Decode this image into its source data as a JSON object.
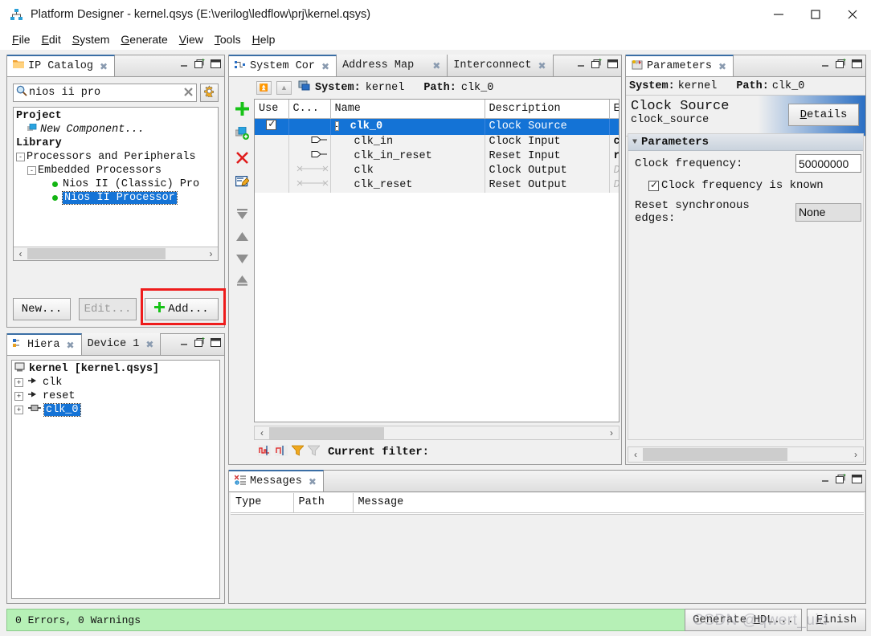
{
  "window": {
    "title": "Platform Designer - kernel.qsys (E:\\verilog\\ledflow\\prj\\kernel.qsys)",
    "icon": "platform-designer-icon",
    "minimize": "—",
    "maximize": "□",
    "close": "✕"
  },
  "menubar": {
    "items": [
      {
        "label": "File",
        "mnemonic": "F"
      },
      {
        "label": "Edit",
        "mnemonic": "E"
      },
      {
        "label": "System",
        "mnemonic": "S"
      },
      {
        "label": "Generate",
        "mnemonic": "G"
      },
      {
        "label": "View",
        "mnemonic": "V"
      },
      {
        "label": "Tools",
        "mnemonic": "T"
      },
      {
        "label": "Help",
        "mnemonic": "H"
      }
    ]
  },
  "ip_catalog": {
    "tab_label": "IP Catalog",
    "tab_close": "✖",
    "search_value": "nios ii pro",
    "search_placeholder": "",
    "clear_label": "✖",
    "tree": [
      {
        "label": "Project",
        "style": "bold",
        "indent": 0,
        "expander": "",
        "icon": "",
        "selected": false
      },
      {
        "label": "New Component...",
        "style": "italic",
        "indent": 1,
        "expander": "",
        "icon": "component-icon",
        "selected": false
      },
      {
        "label": "Library",
        "style": "bold",
        "indent": 0,
        "expander": "",
        "icon": "",
        "selected": false
      },
      {
        "label": "Processors and Peripherals",
        "style": "",
        "indent": 0,
        "expander": "-",
        "icon": "",
        "selected": false
      },
      {
        "label": "Embedded Processors",
        "style": "",
        "indent": 1,
        "expander": "-",
        "icon": "",
        "selected": false
      },
      {
        "label": "Nios II (Classic) Pro",
        "style": "",
        "indent": 2,
        "expander": "",
        "icon": "bullet",
        "selected": false
      },
      {
        "label": "Nios II Processor",
        "style": "",
        "indent": 2,
        "expander": "",
        "icon": "bullet",
        "selected": true
      }
    ],
    "buttons": {
      "new": "New...",
      "edit": "Edit...",
      "add": "Add...",
      "add_icon": "plus-icon"
    },
    "highlight_color": "#ee1c1c"
  },
  "hierarchy": {
    "tabs": [
      {
        "label": "Hiera",
        "active": true,
        "icon": "hierarchy-icon"
      },
      {
        "label": "Device 1",
        "active": false,
        "icon": ""
      }
    ],
    "tree": [
      {
        "label": "kernel [kernel.qsys]",
        "icon": "system-icon",
        "indent": 0,
        "expander": "",
        "bold": true,
        "selected": false
      },
      {
        "label": "clk",
        "icon": "port-icon",
        "indent": 0,
        "expander": "+",
        "bold": false,
        "selected": false
      },
      {
        "label": "reset",
        "icon": "port-icon",
        "indent": 0,
        "expander": "+",
        "bold": false,
        "selected": false
      },
      {
        "label": "clk_0",
        "icon": "module-icon",
        "indent": 0,
        "expander": "+",
        "bold": false,
        "selected": true
      }
    ]
  },
  "system_contents": {
    "tabs": [
      {
        "label": "System Cor",
        "active": true,
        "icon": "system-contents-icon"
      },
      {
        "label": "Address Map",
        "active": false,
        "icon": ""
      },
      {
        "label": "Interconnect",
        "active": false,
        "icon": ""
      }
    ],
    "system_label": "System:",
    "system_value": "kernel",
    "path_label": "Path:",
    "path_value": "clk_0",
    "toolbar_icons": [
      "add-icon",
      "duplicate-icon",
      "remove-icon",
      "edit-icon",
      "move-top-icon",
      "move-up-icon",
      "move-down-icon",
      "move-bottom-icon"
    ],
    "columns": [
      "Use",
      "C...",
      "Name",
      "Description",
      "E:"
    ],
    "rows": [
      {
        "use": true,
        "conn": "",
        "expander": "-",
        "name": "clk_0",
        "description": "Clock Source",
        "export": "",
        "selected": true,
        "indent": 0
      },
      {
        "use": null,
        "conn": "input-arrow",
        "expander": "",
        "name": "clk_in",
        "description": "Clock Input",
        "export": "cl",
        "selected": false,
        "indent": 1
      },
      {
        "use": null,
        "conn": "input-arrow",
        "expander": "",
        "name": "clk_in_reset",
        "description": "Reset Input",
        "export": "re",
        "selected": false,
        "indent": 1
      },
      {
        "use": null,
        "conn": "conn-line",
        "expander": "",
        "name": "clk",
        "description": "Clock Output",
        "export": "Do",
        "selected": false,
        "indent": 1
      },
      {
        "use": null,
        "conn": "conn-line",
        "expander": "",
        "name": "clk_reset",
        "description": "Reset Output",
        "export": "Do",
        "selected": false,
        "indent": 1
      }
    ],
    "filter_label": "Current filter:",
    "filter_value": "",
    "filter_icons": [
      "show-signals-icon",
      "show-connections-icon",
      "filter-icon",
      "clear-filter-icon"
    ]
  },
  "parameters": {
    "tab_label": "Parameters",
    "tab_icon": "parameters-icon",
    "system_label": "System:",
    "system_value": "kernel",
    "path_label": "Path:",
    "path_value": "clk_0",
    "component_title": "Clock Source",
    "component_name": "clock_source",
    "details_button": "Details",
    "details_mnemonic": "D",
    "section_title": "Parameters",
    "fields": [
      {
        "label": "Clock frequency:",
        "value": "50000000",
        "type": "text"
      },
      {
        "label": "Clock frequency is known",
        "value": true,
        "type": "checkbox"
      },
      {
        "label": "Reset synchronous edges:",
        "value": "None",
        "type": "dropdown"
      }
    ]
  },
  "messages": {
    "tab_label": "Messages",
    "tab_icon": "messages-icon",
    "columns": [
      "Type",
      "Path",
      "Message"
    ],
    "rows": []
  },
  "status": {
    "text": "0 Errors, 0 Warnings",
    "background": "#b6f0b6"
  },
  "footer": {
    "generate_button": "Generate HDL...",
    "generate_mnemonic": "H",
    "finish_button": "Finish",
    "finish_mnemonic": "F"
  },
  "watermark": {
    "text": "CSDN @qwert_uid"
  }
}
